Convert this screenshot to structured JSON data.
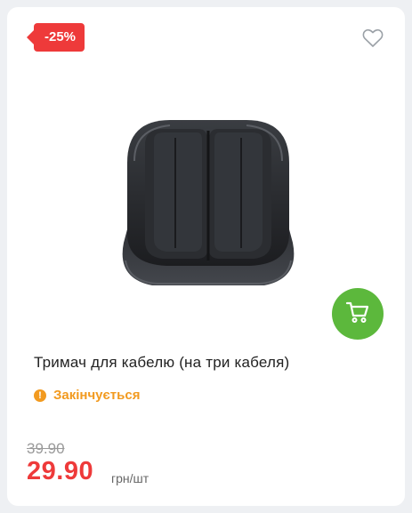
{
  "product": {
    "discount_badge": "-25%",
    "title": "Тримач для кабелю (на три кабеля)",
    "stock_status": "Закінчується",
    "old_price": "39.90",
    "price": "29.90",
    "unit": "грн/шт"
  },
  "icons": {
    "favorite": "heart-outline-icon",
    "cart": "shopping-cart-icon",
    "stock": "exclamation-circle-icon"
  },
  "colors": {
    "badge": "#ee3a3a",
    "price": "#ee3a3a",
    "cart_button": "#5cb83c",
    "stock_warning": "#f29a1f"
  }
}
